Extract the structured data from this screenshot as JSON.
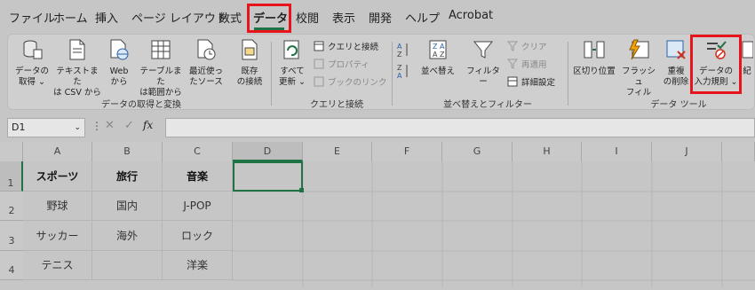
{
  "menu": {
    "tabs": [
      "ファイル",
      "ホーム",
      "挿入",
      "ページ レイアウト",
      "数式",
      "データ",
      "校閲",
      "表示",
      "開発",
      "ヘルプ",
      "Acrobat"
    ],
    "active": "データ"
  },
  "ribbon": {
    "get_data": {
      "buttons": [
        {
          "label1": "データの",
          "label2": "取得 ⌄"
        },
        {
          "label1": "テキストまた",
          "label2": "は CSV から"
        },
        {
          "label1": "Web",
          "label2": "から"
        },
        {
          "label1": "テーブルまた",
          "label2": "は範囲から"
        },
        {
          "label1": "最近使っ",
          "label2": "たソース"
        },
        {
          "label1": "既存",
          "label2": "の接続"
        }
      ],
      "group_label": "データの取得と変換"
    },
    "queries": {
      "refresh": {
        "label1": "すべて",
        "label2": "更新 ⌄"
      },
      "items": [
        "クエリと接続",
        "プロパティ",
        "ブックのリンク"
      ],
      "group_label": "クエリと接続"
    },
    "sort_filter": {
      "sort": "並べ替え",
      "filter": "フィルター",
      "clear": "クリア",
      "reapply": "再適用",
      "advanced": "詳細設定",
      "group_label": "並べ替えとフィルター"
    },
    "data_tools": {
      "text_to_columns": "区切り位置",
      "flash_fill": {
        "label1": "フラッシュ",
        "label2": "フィル"
      },
      "remove_duplicates": {
        "label1": "重複",
        "label2": "の削除"
      },
      "data_validation": {
        "label1": "データの",
        "label2": "入力規則 ⌄"
      },
      "more": "紀",
      "group_label": "データ ツール"
    }
  },
  "formula_bar": {
    "name_box": "D1",
    "fx": "fx"
  },
  "sheet": {
    "columns": [
      "A",
      "B",
      "C",
      "D",
      "E",
      "F",
      "G",
      "H",
      "I",
      "J"
    ],
    "rows": [
      "1",
      "2",
      "3",
      "4"
    ],
    "cells": [
      [
        "スポーツ",
        "旅行",
        "音楽"
      ],
      [
        "野球",
        "国内",
        "J-POP"
      ],
      [
        "サッカー",
        "海外",
        "ロック"
      ],
      [
        "テニス",
        "",
        "洋楽"
      ]
    ]
  },
  "colors": {
    "accent": "#1f7244",
    "highlight": "#e8141b"
  }
}
